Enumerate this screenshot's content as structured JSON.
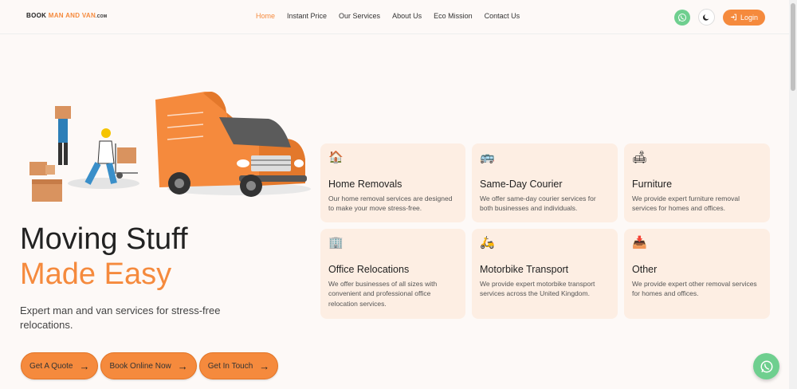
{
  "brand": {
    "logo_part1": "BOOK ",
    "logo_part2": "MAN AND VAN",
    "logo_part3": ".COM",
    "accent_color": "#f58a3d"
  },
  "nav": {
    "items": [
      {
        "label": "Home",
        "active": true
      },
      {
        "label": "Instant Price"
      },
      {
        "label": "Our Services"
      },
      {
        "label": "About Us"
      },
      {
        "label": "Eco Mission"
      },
      {
        "label": "Contact Us"
      }
    ]
  },
  "header_actions": {
    "whatsapp_icon": "whatsapp-icon",
    "theme_icon": "moon-icon",
    "login_label": "Login"
  },
  "hero": {
    "title_line1": "Moving Stuff",
    "title_line2": "Made Easy",
    "subtitle": "Expert man and van services for stress-free relocations.",
    "buttons": [
      {
        "label": "Get A Quote"
      },
      {
        "label": "Book Online Now"
      },
      {
        "label": "Get In Touch"
      }
    ]
  },
  "services": [
    {
      "icon": "🏠",
      "title": "Home Removals",
      "desc": "Our home removal services are designed to make your move stress-free."
    },
    {
      "icon": "🚌",
      "title": "Same-Day Courier",
      "desc": "We offer same-day courier services for both businesses and individuals."
    },
    {
      "icon": "🛋",
      "title": "Furniture",
      "desc": "We provide expert furniture removal services for homes and offices."
    },
    {
      "icon": "🏢",
      "title": "Office Relocations",
      "desc": "We offer businesses of all sizes with convenient and professional office relocation services."
    },
    {
      "icon": "🛵",
      "title": "Motorbike Transport",
      "desc": "We provide expert motorbike transport services across the United Kingdom."
    },
    {
      "icon": "📥",
      "title": "Other",
      "desc": "We provide expert other removal services for homes and offices."
    }
  ]
}
